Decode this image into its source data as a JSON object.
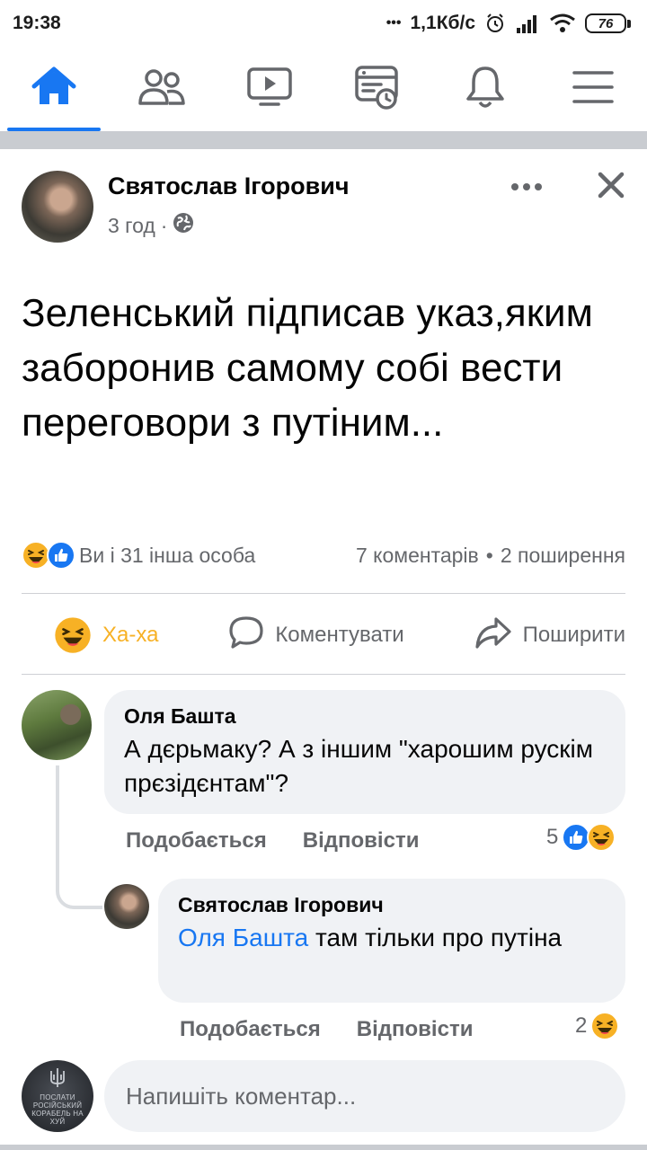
{
  "status_bar": {
    "time": "19:38",
    "dots": "•••",
    "speed": "1,1Кб/с",
    "battery": "76",
    "icons": [
      "alarm-icon",
      "signal-icon",
      "wifi-icon",
      "battery-icon"
    ]
  },
  "nav": {
    "tabs": [
      {
        "name": "home",
        "icon": "home-icon",
        "active": true
      },
      {
        "name": "friends",
        "icon": "friends-icon",
        "active": false
      },
      {
        "name": "watch",
        "icon": "video-icon",
        "active": false
      },
      {
        "name": "feed",
        "icon": "news-icon",
        "active": false
      },
      {
        "name": "notifications",
        "icon": "bell-icon",
        "active": false
      },
      {
        "name": "menu",
        "icon": "menu-icon",
        "active": false
      }
    ],
    "accent": "#1877f2"
  },
  "post": {
    "author": "Святослав Ігорович",
    "time": "3 год",
    "separator": "·",
    "privacy_icon": "globe-icon",
    "text": "Зеленський підписав указ,яким заборонив самому собі вести переговори з путіним...",
    "reactions_text": "Ви і 31 інша особа",
    "comments_count": "7 коментарів",
    "bullet": "•",
    "shares_count": "2 поширення"
  },
  "actions": {
    "reaction": "Ха-ха",
    "comment": "Коментувати",
    "share": "Поширити"
  },
  "comments": [
    {
      "author": "Оля Башта",
      "text": "А дєрьмаку? А з іншим \"харошим рускім прєзідєнтам\"?",
      "like_label": "Подобається",
      "reply_label": "Відповісти",
      "reaction_count": "5"
    },
    {
      "author": "Святослав Ігорович",
      "mention": "Оля Башта",
      "text": " там тільки про путіна",
      "like_label": "Подобається",
      "reply_label": "Відповісти",
      "reaction_count": "2"
    }
  ],
  "composer": {
    "placeholder": "Напишіть коментар...",
    "avatar_text": "ПОСЛАТИ РОСІЙСЬКИЙ КОРАБЕЛЬ НА ХУЙ"
  },
  "colors": {
    "haha": "#f7b125",
    "like": "#1877f2",
    "muted": "#65676b"
  }
}
